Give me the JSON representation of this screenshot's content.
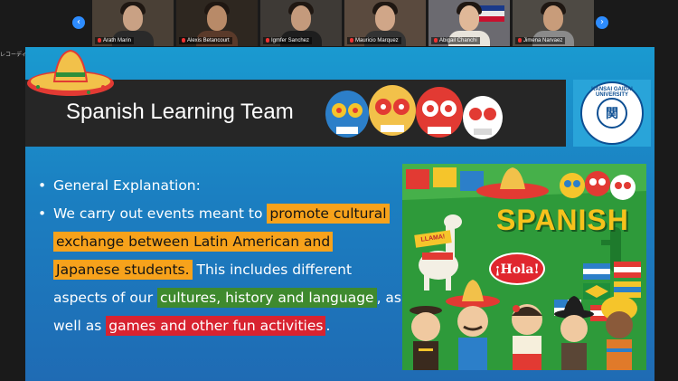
{
  "meeting": {
    "notice": "レコーディングしています",
    "participants": [
      {
        "name": "Arath Marin"
      },
      {
        "name": "Alexis Betancourt"
      },
      {
        "name": "Igmfer Sanchez"
      },
      {
        "name": "Mauricio Marquez"
      },
      {
        "name": "Abigail Chanchi"
      },
      {
        "name": "Jimena Narvaez"
      }
    ]
  },
  "slide": {
    "title": "Spanish Learning Team",
    "logo_text": "KANSAI GAIDAI UNIVERSITY",
    "bullets": [
      {
        "text": "General Explanation:"
      },
      {
        "parts": [
          {
            "text": "We carry out events meant to "
          },
          {
            "text": "promote cultural",
            "hl": "orange"
          },
          {
            "text": " "
          },
          {
            "text": "exchange between Latin American and",
            "hl": "orange"
          },
          {
            "text": " "
          },
          {
            "text": "Japanese students.",
            "hl": "orange"
          },
          {
            "text": " This includes different aspects of our "
          },
          {
            "text": "cultures, history and language",
            "hl": "green"
          },
          {
            "text": ", as well as "
          },
          {
            "text": "games and other fun activities",
            "hl": "red"
          },
          {
            "text": "."
          }
        ]
      }
    ],
    "poster": {
      "word": "SPANISH",
      "bubble": "¡Hola!",
      "llama_sign": "LLAMA!"
    }
  },
  "colors": {
    "slide_blue": "#1b7fc1",
    "title_bar": "#262626",
    "highlight_orange": "#f7a21b",
    "highlight_green": "#3f8a2e",
    "highlight_red": "#d82330",
    "zoom_accent": "#2d8cff"
  },
  "icons": [
    "chevron-left-icon",
    "chevron-right-icon",
    "muted-mic-icon",
    "sombrero-icon",
    "sugar-skull-icon",
    "university-logo-icon"
  ]
}
